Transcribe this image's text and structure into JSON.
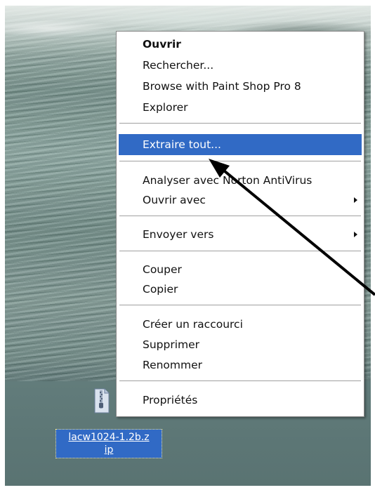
{
  "context_menu": {
    "items": [
      {
        "label": "Ouvrir",
        "default": true
      },
      {
        "label": "Rechercher..."
      },
      {
        "label": "Browse with Paint Shop Pro 8"
      },
      {
        "label": "Explorer"
      },
      {
        "label": "Extraire tout...",
        "highlighted": true
      },
      {
        "label": "Analyser avec Norton AntiVirus"
      },
      {
        "label": "Ouvrir avec",
        "submenu": true
      },
      {
        "label": "Envoyer vers",
        "submenu": true
      },
      {
        "label": "Couper"
      },
      {
        "label": "Copier"
      },
      {
        "label": "Créer un raccourci"
      },
      {
        "label": "Supprimer"
      },
      {
        "label": "Renommer"
      },
      {
        "label": "Propriétés"
      }
    ],
    "highlight_color": "#316ac5"
  },
  "desktop_file": {
    "name_line1": "lacw1024-1.2b.z",
    "name_line2": "ip",
    "icon": "zip-folder-icon",
    "selection_color": "#316ac5"
  },
  "annotation": {
    "arrow_color": "#000000",
    "icon": "pointer-arrow-icon"
  }
}
